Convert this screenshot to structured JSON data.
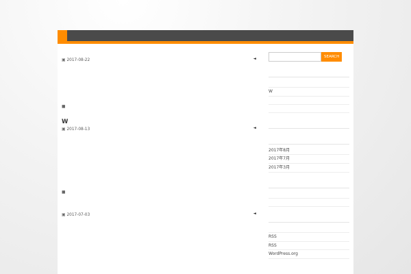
{
  "site": {
    "title": ""
  },
  "nav": {
    "items": [
      {
        "label": ""
      }
    ]
  },
  "posts": [
    {
      "title": "",
      "date": "2017-08-22",
      "comments": "",
      "paragraphs": [
        {
          "text": "",
          "link": ""
        },
        {
          "text": "",
          "link": ""
        }
      ],
      "category": ""
    },
    {
      "title": "W",
      "date": "2017-08-13",
      "comments": "",
      "paragraphs": [
        {
          "text": "",
          "link": ""
        },
        {
          "text": "",
          "link": ""
        },
        {
          "text": "",
          "link": ""
        }
      ],
      "category": ""
    },
    {
      "title": "",
      "date": "2017-07-03",
      "comments": ""
    }
  ],
  "sidebar": {
    "search": {
      "placeholder": "",
      "button": "SEARCH"
    },
    "recent": {
      "title": "",
      "items": [
        "",
        "W",
        "",
        ""
      ]
    },
    "comments": {
      "title": ""
    },
    "archives": {
      "title": "",
      "items": [
        "2017年8月",
        "2017年7月",
        "2017年3月"
      ]
    },
    "categories": {
      "title": "",
      "items": [
        "",
        ""
      ]
    },
    "meta": {
      "title": "",
      "items": [
        "",
        "RSS",
        "RSS",
        "WordPress.org"
      ]
    }
  },
  "icons": {
    "date": "calendar-icon",
    "comments": "comment-icon",
    "category": "folder-icon"
  },
  "colors": {
    "accent": "#ff8c00",
    "nav_bg": "#4a4a4a",
    "link": "#e68a00"
  }
}
